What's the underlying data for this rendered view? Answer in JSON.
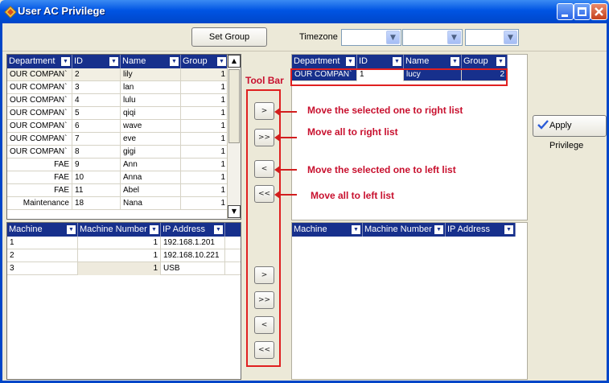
{
  "window": {
    "title": "User AC Privilege",
    "buttons": [
      "minimize",
      "maximize",
      "close"
    ]
  },
  "toolbar": {
    "set_group_label": "Set Group",
    "timezone_label": "Timezone",
    "timezone_values": [
      "",
      "",
      ""
    ]
  },
  "left_users": {
    "headers": [
      "Department",
      "ID",
      "Name",
      "Group"
    ],
    "rows": [
      {
        "department": "OUR COMPAN`",
        "id": "2",
        "name": "lily",
        "group": "1"
      },
      {
        "department": "OUR COMPAN`",
        "id": "3",
        "name": "lan",
        "group": "1"
      },
      {
        "department": "OUR COMPAN`",
        "id": "4",
        "name": "lulu",
        "group": "1"
      },
      {
        "department": "OUR COMPAN`",
        "id": "5",
        "name": "qiqi",
        "group": "1"
      },
      {
        "department": "OUR COMPAN`",
        "id": "6",
        "name": "wave",
        "group": "1"
      },
      {
        "department": "OUR COMPAN`",
        "id": "7",
        "name": "eve",
        "group": "1"
      },
      {
        "department": "OUR COMPAN`",
        "id": "8",
        "name": "gigi",
        "group": "1"
      },
      {
        "department": "FAE",
        "id": "9",
        "name": "Ann",
        "group": "1"
      },
      {
        "department": "FAE",
        "id": "10",
        "name": "Anna",
        "group": "1"
      },
      {
        "department": "FAE",
        "id": "11",
        "name": "Abel",
        "group": "1"
      },
      {
        "department": "Maintenance",
        "id": "18",
        "name": "Nana",
        "group": "1"
      }
    ]
  },
  "left_machines": {
    "headers": [
      "Machine",
      "Machine Number",
      "IP Address"
    ],
    "rows": [
      {
        "machine": "1",
        "number": "1",
        "ip": "192.168.1.201"
      },
      {
        "machine": "2",
        "number": "1",
        "ip": "192.168.10.221"
      },
      {
        "machine": "3",
        "number": "1",
        "ip": "USB"
      }
    ]
  },
  "right_users": {
    "headers": [
      "Department",
      "ID",
      "Name",
      "Group"
    ],
    "rows": [
      {
        "department": "OUR COMPAN`",
        "id": "1",
        "name": "lucy",
        "group": "2"
      }
    ]
  },
  "right_machines": {
    "headers": [
      "Machine",
      "Machine Number",
      "IP Address"
    ]
  },
  "tool_buttons": {
    "move_right": ">",
    "move_all_right": ">>",
    "move_left": "<",
    "move_all_left": "<<"
  },
  "annotations": {
    "tool_bar": "Tool Bar",
    "move_right": "Move the selected one to right list",
    "move_all_right": "Move all to right list",
    "move_left": "Move the selected one to left list",
    "move_all_left": "Move all to left list"
  },
  "apply_label": "Apply Privilege",
  "colors": {
    "title_bar": "#0054e3",
    "grid_header": "#17308c",
    "annotation_red": "#c8102e"
  }
}
